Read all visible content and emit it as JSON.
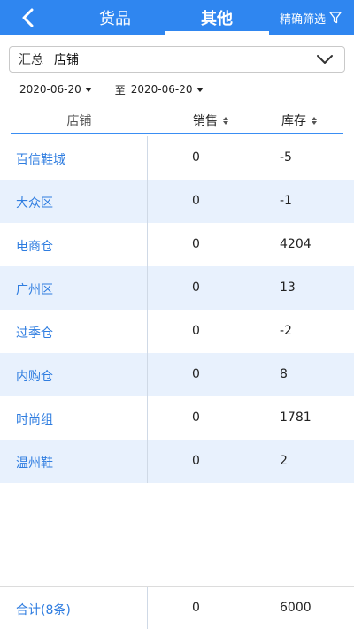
{
  "header": {
    "back_label": "",
    "tabs": [
      {
        "label": "货品"
      },
      {
        "label": "其他"
      }
    ],
    "filter_label": "精确筛选",
    "bg_color": "#2f86f0"
  },
  "summary": {
    "label": "汇总",
    "value": "店铺"
  },
  "dates": {
    "start": "2020-06-20",
    "to": "至",
    "end": "2020-06-20"
  },
  "table": {
    "columns": {
      "store": "店铺",
      "sales": "销售",
      "stock": "库存"
    },
    "rows": [
      {
        "store": "百信鞋城",
        "sales": "0",
        "stock": "-5"
      },
      {
        "store": "大众区",
        "sales": "0",
        "stock": "-1"
      },
      {
        "store": "电商仓",
        "sales": "0",
        "stock": "4204"
      },
      {
        "store": "广州区",
        "sales": "0",
        "stock": "13"
      },
      {
        "store": "过季仓",
        "sales": "0",
        "stock": "-2"
      },
      {
        "store": "内购仓",
        "sales": "0",
        "stock": "8"
      },
      {
        "store": "时尚组",
        "sales": "0",
        "stock": "1781"
      },
      {
        "store": "温州鞋",
        "sales": "0",
        "stock": "2"
      }
    ]
  },
  "footer": {
    "total_label": "合计(8条)",
    "total_sales": "0",
    "total_stock": "6000"
  }
}
